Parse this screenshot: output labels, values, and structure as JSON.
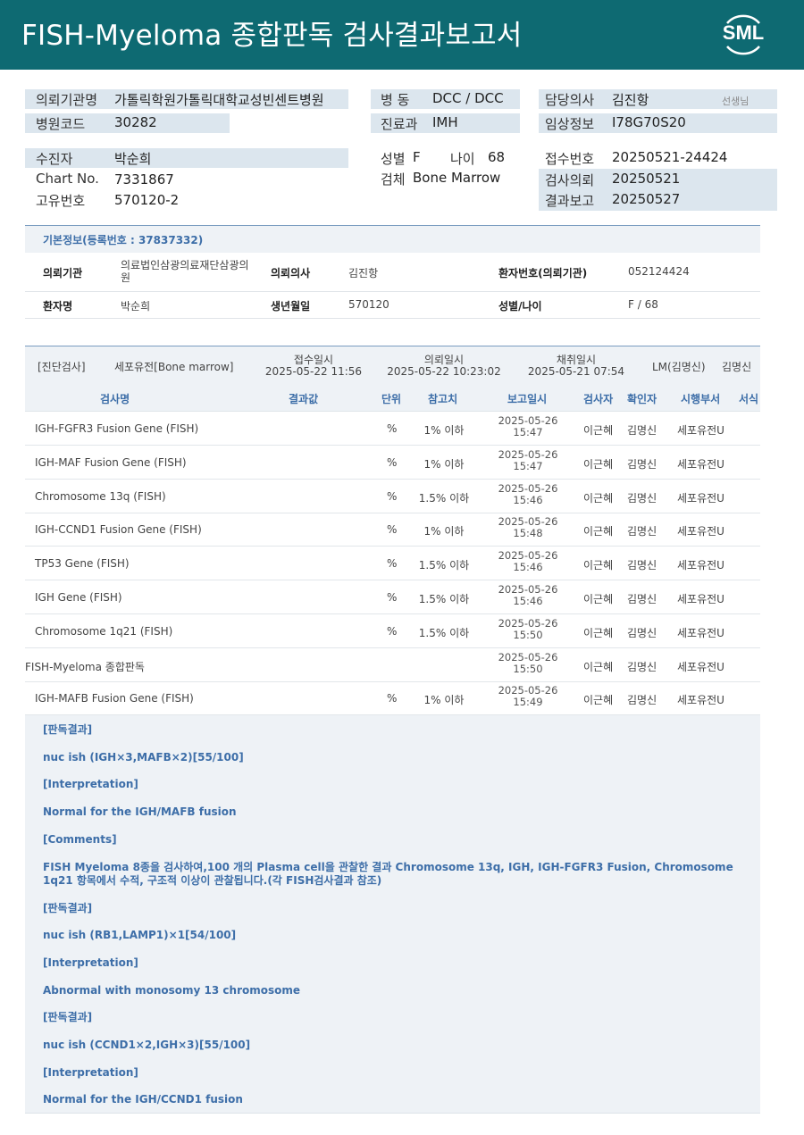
{
  "header": {
    "title": "FISH-Myeloma 종합판독 검사결과보고서",
    "logo_text": "SML"
  },
  "patient_block": {
    "hospital_label": "의뢰기관명",
    "hospital_value": "가톨릭학원가톨릭대학교성빈센트병원",
    "code_label": "병원코드",
    "code_value": "30282",
    "ward_label": "병  동",
    "ward_value": "DCC / DCC",
    "dept_label": "진료과",
    "dept_value": "IMH",
    "doctor_label": "담당의사",
    "doctor_value": "김진항",
    "doctor_suffix": "선생님",
    "clinical_label": "임상정보",
    "clinical_value": "I78G70S20",
    "name_label": "수진자",
    "name_value": "박순희",
    "chart_label": "Chart No.",
    "chart_value": "7331867",
    "uid_label": "고유번호",
    "uid_value": "570120-2",
    "sex_label": "성별",
    "sex_value": "F",
    "age_label": "나이",
    "age_value": "68",
    "specimen_label": "검체",
    "specimen_value": "Bone Marrow",
    "receipt_label": "접수번호",
    "receipt_value": "20250521-24424",
    "request_label": "검사의뢰",
    "request_value": "20250521",
    "report_label": "결과보고",
    "report_value": "20250527"
  },
  "basic_info": {
    "heading": "기본정보(등록번호 : 37837332)",
    "inst_label": "의뢰기관",
    "inst_value": "의료법인삼광의료재단삼광의원",
    "doc_label": "의뢰의사",
    "doc_value": "김진항",
    "pno_label": "환자번호(의뢰기관)",
    "pno_value": "052124424",
    "pname_label": "환자명",
    "pname_value": "박순희",
    "dob_label": "생년월일",
    "dob_value": "570120",
    "sexage_label": "성별/나이",
    "sexage_value": "F / 68"
  },
  "exam": {
    "category": "[진단검사]",
    "specimen": "세포유전[Bone marrow]",
    "receipt_label": "접수일시",
    "receipt_value": "2025-05-22 11:56",
    "request_label": "의뢰일시",
    "request_value": "2025-05-22 10:23:02",
    "collect_label": "채취일시",
    "collect_value": "2025-05-21 07:54",
    "lm": "LM(김명신)",
    "lm_name": "김명신",
    "columns": [
      "검사명",
      "결과값",
      "단위",
      "참고치",
      "보고일시",
      "검사자",
      "확인자",
      "시행부서",
      "서식"
    ],
    "rows": [
      {
        "name": "IGH-FGFR3 Fusion Gene (FISH)",
        "unit": "%",
        "ref": "1% 이하",
        "date": "2025-05-26",
        "time": "15:47",
        "tester": "이근혜",
        "checker": "김명신",
        "dept": "세포유전U"
      },
      {
        "name": "IGH-MAF Fusion Gene (FISH)",
        "unit": "%",
        "ref": "1% 이하",
        "date": "2025-05-26",
        "time": "15:47",
        "tester": "이근혜",
        "checker": "김명신",
        "dept": "세포유전U"
      },
      {
        "name": "Chromosome 13q (FISH)",
        "unit": "%",
        "ref": "1.5% 이하",
        "date": "2025-05-26",
        "time": "15:46",
        "tester": "이근혜",
        "checker": "김명신",
        "dept": "세포유전U"
      },
      {
        "name": "IGH-CCND1 Fusion Gene (FISH)",
        "unit": "%",
        "ref": "1% 이하",
        "date": "2025-05-26",
        "time": "15:48",
        "tester": "이근혜",
        "checker": "김명신",
        "dept": "세포유전U"
      },
      {
        "name": "TP53 Gene (FISH)",
        "unit": "%",
        "ref": "1.5% 이하",
        "date": "2025-05-26",
        "time": "15:46",
        "tester": "이근혜",
        "checker": "김명신",
        "dept": "세포유전U"
      },
      {
        "name": "IGH Gene (FISH)",
        "unit": "%",
        "ref": "1.5% 이하",
        "date": "2025-05-26",
        "time": "15:46",
        "tester": "이근혜",
        "checker": "김명신",
        "dept": "세포유전U"
      },
      {
        "name": "Chromosome 1q21 (FISH)",
        "unit": "%",
        "ref": "1.5% 이하",
        "date": "2025-05-26",
        "time": "15:50",
        "tester": "이근혜",
        "checker": "김명신",
        "dept": "세포유전U"
      },
      {
        "name": "FISH-Myeloma 종합판독",
        "unit": "",
        "ref": "",
        "date": "2025-05-26",
        "time": "15:50",
        "tester": "이근혜",
        "checker": "김명신",
        "dept": "세포유전U"
      },
      {
        "name": "IGH-MAFB Fusion Gene (FISH)",
        "unit": "%",
        "ref": "1% 이하",
        "date": "2025-05-26",
        "time": "15:49",
        "tester": "이근혜",
        "checker": "김명신",
        "dept": "세포유전U"
      }
    ]
  },
  "results": [
    "[판독결과]",
    "nuc ish (IGH×3,MAFB×2)[55/100]",
    "[Interpretation]",
    "Normal for the IGH/MAFB fusion",
    "[Comments]",
    "FISH Myeloma 8종을 검사하여,100 개의 Plasma cell을 관찰한 결과 Chromosome 13q, IGH, IGH-FGFR3 Fusion,  Chromosome 1q21 항목에서 수적, 구조적 이상이 관찰됩니다.(각 FISH검사결과 참조)",
    "[판독결과]",
    "nuc ish (RB1,LAMP1)×1[54/100]",
    "[Interpretation]",
    "Abnormal with monosomy 13 chromosome",
    "[판독결과]",
    "nuc ish (CCND1×2,IGH×3)[55/100]",
    "[Interpretation]",
    "Normal for the IGH/CCND1 fusion"
  ]
}
